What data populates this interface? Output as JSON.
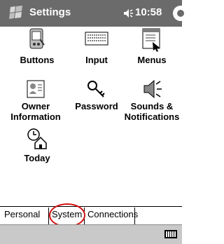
{
  "status_bar": {
    "title": "Settings",
    "time": "10:58"
  },
  "settings_items": [
    {
      "name": "Buttons",
      "icon": "buttons-icon"
    },
    {
      "name": "Input",
      "icon": "keyboard-icon"
    },
    {
      "name": "Menus",
      "icon": "menus-icon"
    },
    {
      "name": "Owner Information",
      "icon": "owner-card-icon"
    },
    {
      "name": "Password",
      "icon": "key-icon"
    },
    {
      "name": "Sounds & Notifications",
      "icon": "speaker-icon"
    },
    {
      "name": "Today",
      "icon": "today-house-icon"
    }
  ],
  "tabs": [
    {
      "label": "Personal"
    },
    {
      "label": "System"
    },
    {
      "label": "Connections"
    }
  ],
  "annotation": {
    "target": "System",
    "color": "#d41010"
  },
  "colors": {
    "title_bar": "#6b6b6b",
    "bottom_bar": "#c9c9c9"
  }
}
